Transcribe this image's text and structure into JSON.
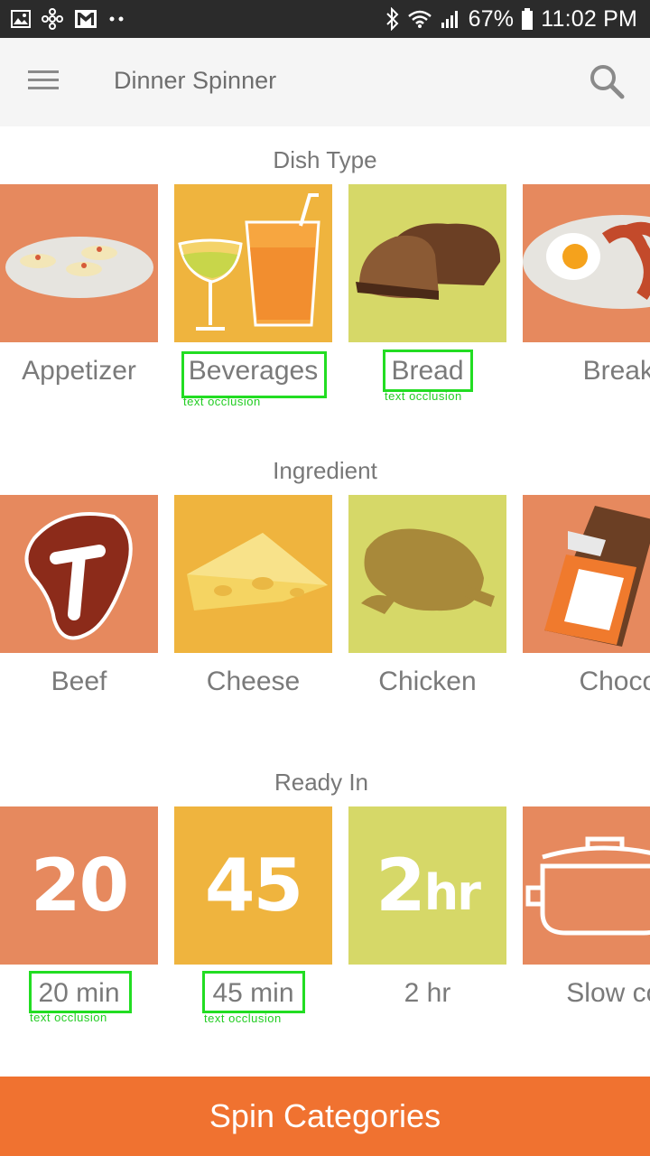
{
  "status_bar": {
    "battery_percent": "67%",
    "time": "11:02 PM",
    "icons_left": [
      "image-icon",
      "fan-icon",
      "gmail-icon",
      "more-dots-icon"
    ],
    "icons_right": [
      "bluetooth-icon",
      "wifi-icon",
      "signal-icon",
      "battery-icon"
    ]
  },
  "app_bar": {
    "title": "Dinner Spinner",
    "menu_icon": "hamburger-menu-icon",
    "search_icon": "search-icon"
  },
  "sections": {
    "dish_type": {
      "title": "Dish Type",
      "items": [
        {
          "label": "Appetizer",
          "icon": "appetizer-plate-icon",
          "bg": "#e6895e"
        },
        {
          "label": "Beverages",
          "icon": "drinks-icon",
          "bg": "#efb43e"
        },
        {
          "label": "Bread",
          "icon": "bread-loaf-icon",
          "bg": "#d6d868"
        },
        {
          "label": "Breakfast",
          "icon": "egg-bacon-icon",
          "bg": "#e6895e"
        }
      ]
    },
    "ingredient": {
      "title": "Ingredient",
      "items": [
        {
          "label": "Beef",
          "icon": "steak-icon",
          "bg": "#e6895e"
        },
        {
          "label": "Cheese",
          "icon": "cheese-icon",
          "bg": "#efb43e"
        },
        {
          "label": "Chicken",
          "icon": "roast-chicken-icon",
          "bg": "#d6d868"
        },
        {
          "label": "Chocolate",
          "icon": "chocolate-bar-icon",
          "bg": "#e6895e"
        }
      ]
    },
    "ready_in": {
      "title": "Ready In",
      "items": [
        {
          "label": "20 min",
          "icon": "twenty-icon",
          "glyph": "20",
          "bg": "#e6895e"
        },
        {
          "label": "45 min",
          "icon": "forty-five-icon",
          "glyph": "45",
          "bg": "#efb43e"
        },
        {
          "label": "2 hr",
          "icon": "two-hour-icon",
          "glyph": "2",
          "glyph_suffix": "hr",
          "bg": "#d6d868"
        },
        {
          "label": "Slow cooker",
          "icon": "slow-cooker-pot-icon",
          "bg": "#e6895e"
        }
      ]
    }
  },
  "annotations": {
    "occlusion_label": "text occlusion"
  },
  "spin_button": {
    "label": "Spin Categories"
  },
  "colors": {
    "accent": "#f07230",
    "orange_tile": "#e6895e",
    "yellow_tile": "#efb43e",
    "green_tile": "#d6d868",
    "status_bar": "#2b2b2b",
    "app_bar": "#f5f5f5",
    "annotation_green": "#22dd22"
  }
}
